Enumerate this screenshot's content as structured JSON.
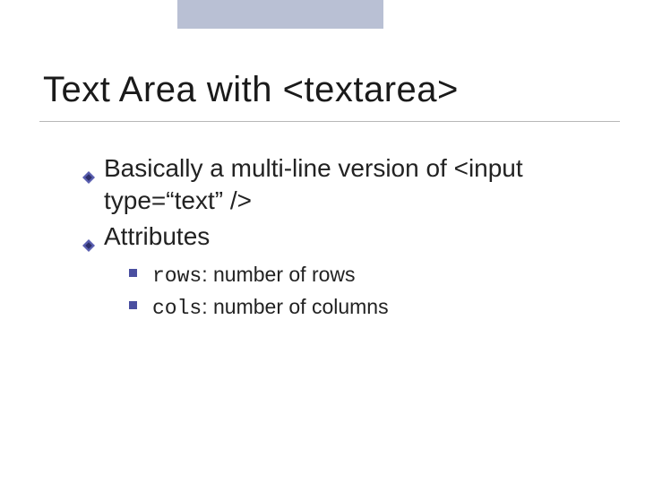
{
  "title": "Text Area with <textarea>",
  "bullets": [
    {
      "text": "Basically a multi-line version of <input type=“text” />"
    },
    {
      "text": "Attributes"
    }
  ],
  "subbullets": [
    {
      "code": "rows",
      "rest": ": number of rows"
    },
    {
      "code": "cols",
      "rest": ": number of columns"
    }
  ],
  "colors": {
    "accent": "#4a4fa0",
    "topbar": "#b9c0d4"
  }
}
